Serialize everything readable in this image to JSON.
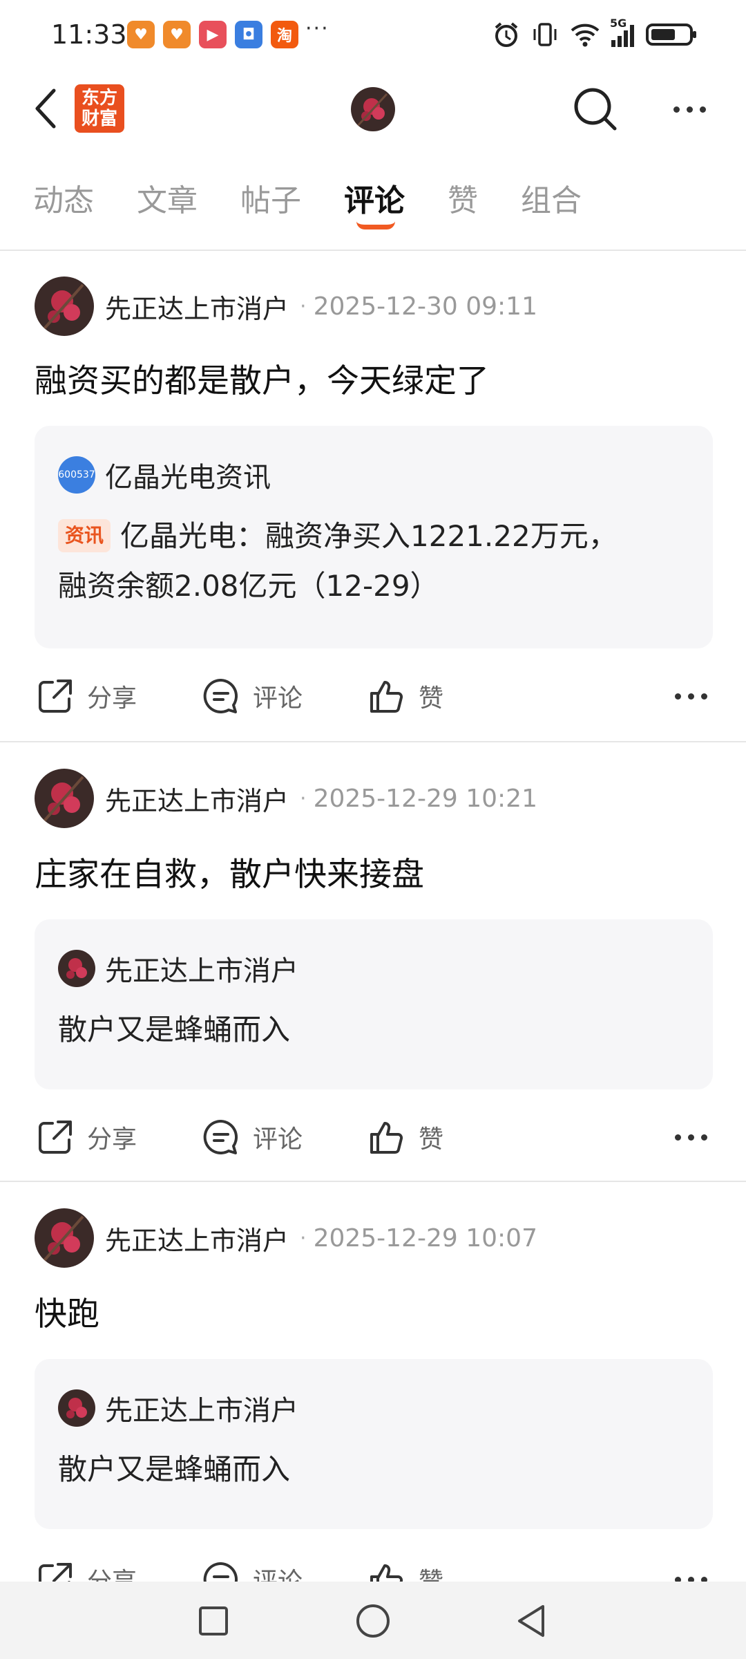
{
  "status_bar": {
    "time": "11:33",
    "app_icons": [
      {
        "name": "heart-app-icon",
        "color": "#f08a2b",
        "glyph": "♥"
      },
      {
        "name": "heart-app-icon-2",
        "color": "#f08a2b",
        "glyph": "♥"
      },
      {
        "name": "video-app-icon",
        "color": "#e8505b",
        "glyph": "▶"
      },
      {
        "name": "shield-app-icon",
        "color": "#3a7ee0",
        "glyph": "◘"
      },
      {
        "name": "taobao-app-icon",
        "color": "#f25a0f",
        "glyph": "淘"
      }
    ],
    "more": "···",
    "network": "5G"
  },
  "header": {
    "brand_line1": "东方",
    "brand_line2": "财富"
  },
  "tabs": [
    {
      "label": "动态",
      "active": false
    },
    {
      "label": "文章",
      "active": false
    },
    {
      "label": "帖子",
      "active": false
    },
    {
      "label": "评论",
      "active": true
    },
    {
      "label": "赞",
      "active": false
    },
    {
      "label": "组合",
      "active": false
    }
  ],
  "posts": [
    {
      "author": "先正达上市消户",
      "sep": "·",
      "time": "2025-12-30 09:11",
      "text": "融资买的都是散户，今天绿定了",
      "quote": {
        "badge": "600537",
        "name": "亿晶光电资讯",
        "tag": "资讯",
        "line1": "亿晶光电：融资净买入1221.22万元，",
        "line2": "融资余额2.08亿元（12-29）"
      }
    },
    {
      "author": "先正达上市消户",
      "sep": "·",
      "time": "2025-12-29 10:21",
      "text": "庄家在自救，散户快来接盘",
      "quote": {
        "name": "先正达上市消户",
        "body": "散户又是蜂蛹而入"
      }
    },
    {
      "author": "先正达上市消户",
      "sep": "·",
      "time": "2025-12-29 10:07",
      "text": "快跑",
      "quote": {
        "name": "先正达上市消户",
        "body": "散户又是蜂蛹而入"
      }
    }
  ],
  "actions": {
    "share": "分享",
    "comment": "评论",
    "like": "赞"
  },
  "colors": {
    "accent": "#f15a22",
    "quote_bg": "#f6f6f8",
    "tag_bg": "#fde5da",
    "badge_blue": "#3b7fe0"
  }
}
